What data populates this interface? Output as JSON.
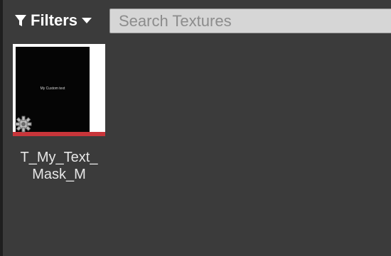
{
  "toolbar": {
    "filters_label": "Filters",
    "search_placeholder": "Search Textures"
  },
  "assets": [
    {
      "name": "T_My_Text_Mask_M",
      "label_line1": "T_My_Text_",
      "label_line2": "Mask_M",
      "thumbnail_text": "My Custom text",
      "type_bar_color": "#c8353a"
    }
  ],
  "colors": {
    "panel_bg": "#3b3b3b",
    "search_bg": "#d6d6d6",
    "accent_texture": "#c8353a"
  }
}
